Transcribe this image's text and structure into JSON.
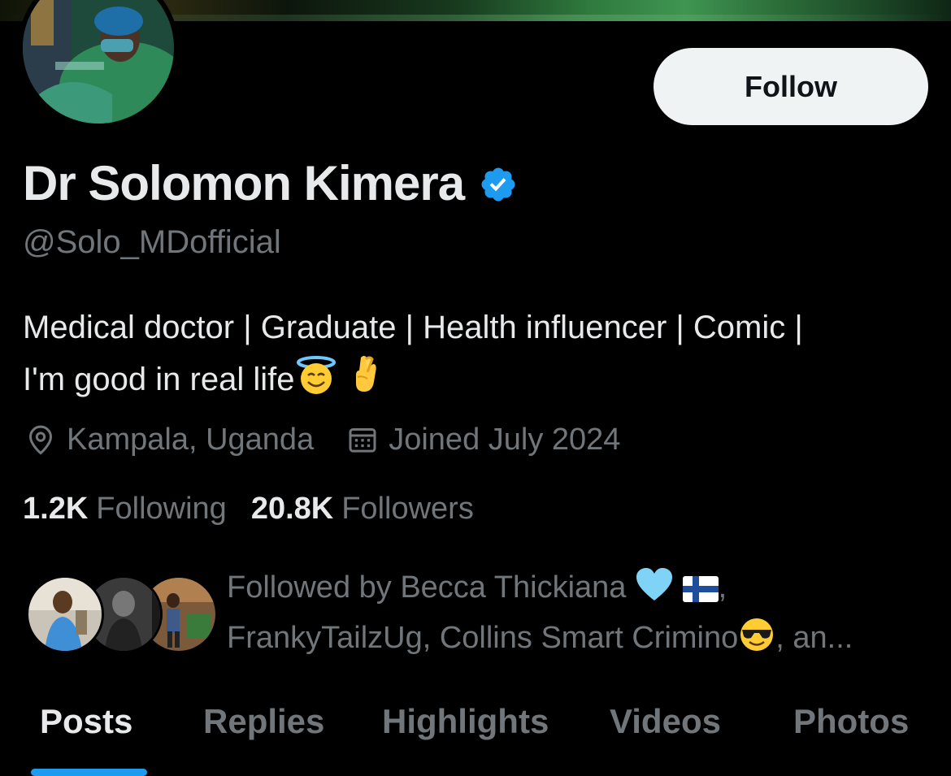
{
  "profile": {
    "display_name": "Dr Solomon Kimera",
    "handle": "@Solo_MDofficial",
    "bio_line1": "Medical doctor | Graduate | Health influencer | Comic |",
    "bio_line2": "I'm good in real life",
    "location": "Kampala, Uganda",
    "joined": "Joined July 2024",
    "verified": true
  },
  "actions": {
    "follow_label": "Follow"
  },
  "stats": {
    "following_count": "1.2K",
    "following_label": "Following",
    "followers_count": "20.8K",
    "followers_label": "Followers"
  },
  "followed_by": {
    "line1": "Followed by Becca Thickiana",
    "line1_suffix": ",",
    "line2": "FrankyTailzUg, Collins Smart Crimino",
    "line2_suffix": ", an..."
  },
  "tabs": [
    {
      "label": "Posts",
      "active": true
    },
    {
      "label": "Replies",
      "active": false
    },
    {
      "label": "Highlights",
      "active": false
    },
    {
      "label": "Videos",
      "active": false
    },
    {
      "label": "Photos",
      "active": false
    }
  ],
  "colors": {
    "background": "#000000",
    "text_primary": "#e7e9ea",
    "text_secondary": "#71767b",
    "accent": "#1d9bf0",
    "follow_button_bg": "#eff3f4"
  },
  "icons": {
    "verified": "verified-badge-icon",
    "location": "location-pin-icon",
    "calendar": "calendar-icon",
    "halo_emoji": "smiling-face-with-halo-emoji",
    "crossed_fingers_emoji": "crossed-fingers-emoji",
    "blue_heart_emoji": "light-blue-heart-emoji",
    "finland_flag_emoji": "finland-flag-emoji",
    "sunglasses_emoji": "sunglasses-face-emoji"
  }
}
